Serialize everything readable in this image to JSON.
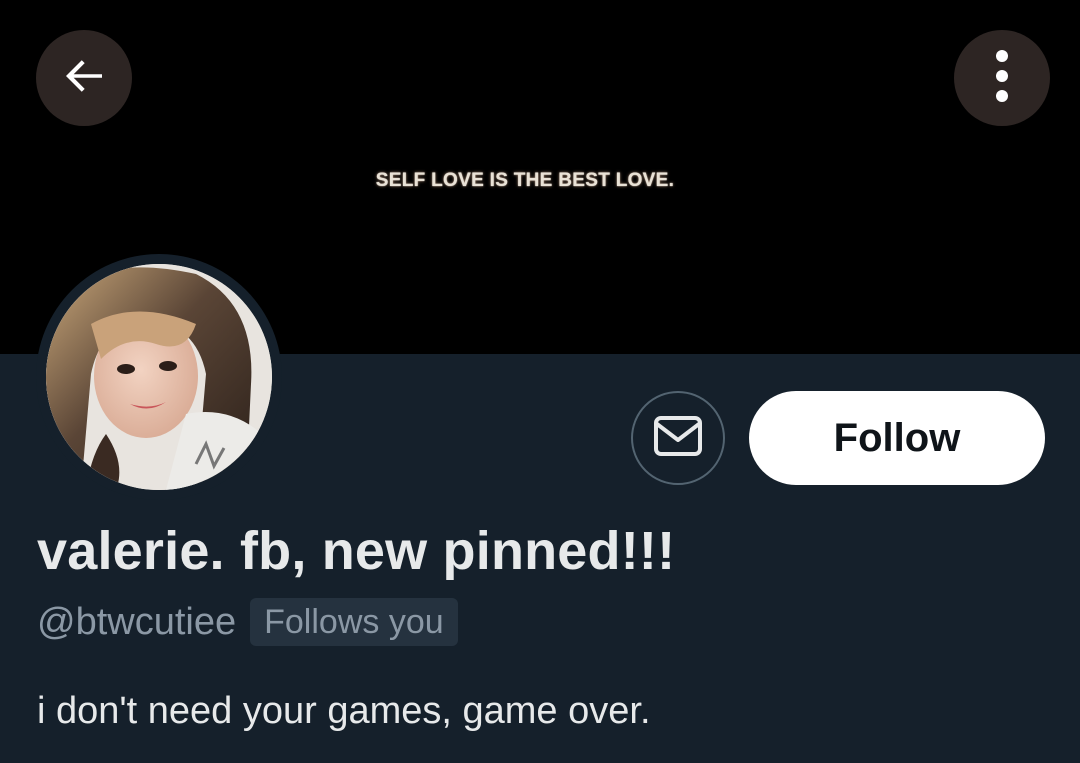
{
  "banner": {
    "text": "SELF LOVE IS THE BEST LOVE."
  },
  "header": {
    "back_icon": "arrow-left-icon",
    "more_icon": "more-vertical-icon"
  },
  "profile": {
    "display_name": "valerie. fb, new pinned!!!",
    "handle": "@btwcutiee",
    "follows_you_badge": "Follows you",
    "bio": "i don't need your games, game over.",
    "message_icon": "envelope-icon",
    "follow_label": "Follow"
  },
  "colors": {
    "background": "#15202b",
    "banner": "#000000",
    "primary_text": "#e7e9ea",
    "secondary_text": "#8b98a5",
    "follow_button_bg": "#ffffff",
    "follow_button_text": "#0f1419",
    "border": "#536471",
    "circle_button_bg": "#312826"
  }
}
